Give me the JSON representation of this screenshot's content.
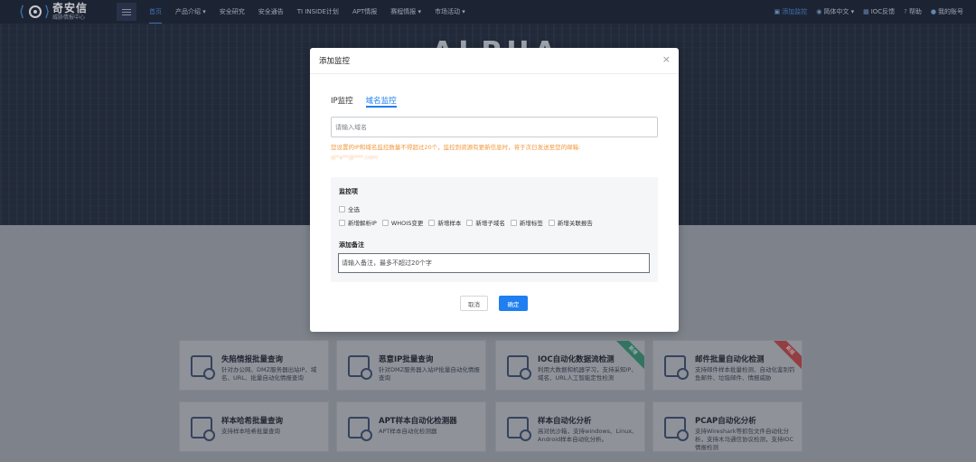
{
  "brand": {
    "name": "奇安信",
    "sub": "威胁情报中心"
  },
  "nav": {
    "items": [
      "首页",
      "产品介绍",
      "安全研究",
      "安全通告",
      "TI INSIDE计划",
      "APT情报",
      "赛程情报",
      "市场活动"
    ],
    "dropdown_marker": "▾",
    "right": [
      {
        "icon": "▣",
        "label": "添加监控"
      },
      {
        "icon": "◉",
        "label": "简体中文"
      },
      {
        "icon": "▦",
        "label": "IOC反馈"
      },
      {
        "icon": "?",
        "label": "帮助"
      },
      {
        "icon": "●",
        "label": "我的账号"
      }
    ]
  },
  "hero": {
    "title": "ALPHA"
  },
  "cards": [
    {
      "title": "失陷情报批量查询",
      "desc": "针对办公网、DMZ服务器出站IP、域名、URL、批量自动化情报查询"
    },
    {
      "title": "恶意IP批量查询",
      "desc": "针对DMZ服务器入站IP批量自动化情报查询"
    },
    {
      "title": "IOC自动化数据流检测",
      "desc": "利用大数据和机器学习，支持采知IP、域名、URL人工智能定性检测",
      "badge": "新增"
    },
    {
      "title": "邮件批量自动化检测",
      "desc": "支持邮件样本批量检测、自动化鉴别钓鱼邮件、垃圾邮件、情报威胁",
      "badge": "新版"
    },
    {
      "title": "样本哈希批量查询",
      "desc": "支持样本哈希批量查询"
    },
    {
      "title": "APT样本自动化检测器",
      "desc": "APT样本自动化检测器"
    },
    {
      "title": "样本自动化分析",
      "desc": "高对抗沙箱，支持windows、Linux、Android样本自动化分析。"
    },
    {
      "title": "PCAP自动化分析",
      "desc": "支持Wireshark等抓包文件自动化分析，支持木马通信协议检测，支持IOC情报检测"
    }
  ],
  "dialog": {
    "title": "添加监控",
    "close": "×",
    "tabs": [
      "IP监控",
      "域名监控"
    ],
    "active_tab": 1,
    "domain_placeholder": "请输入域名",
    "notice": "您设置的IP和域名监控数量不得超过20个，监控到资源有更新信息时，将于次日发送至您的邮箱:",
    "email": "qi*a**@***.com",
    "monitor_label": "监控项",
    "select_all": "全选",
    "options": [
      "新增解析IP",
      "WHOIS变更",
      "新增样本",
      "新增子域名",
      "新增标签",
      "新增关联报告"
    ],
    "note_label": "添加备注",
    "note_placeholder": "请输入备注，最多不超过20个字",
    "cancel": "取消",
    "ok": "确定"
  }
}
